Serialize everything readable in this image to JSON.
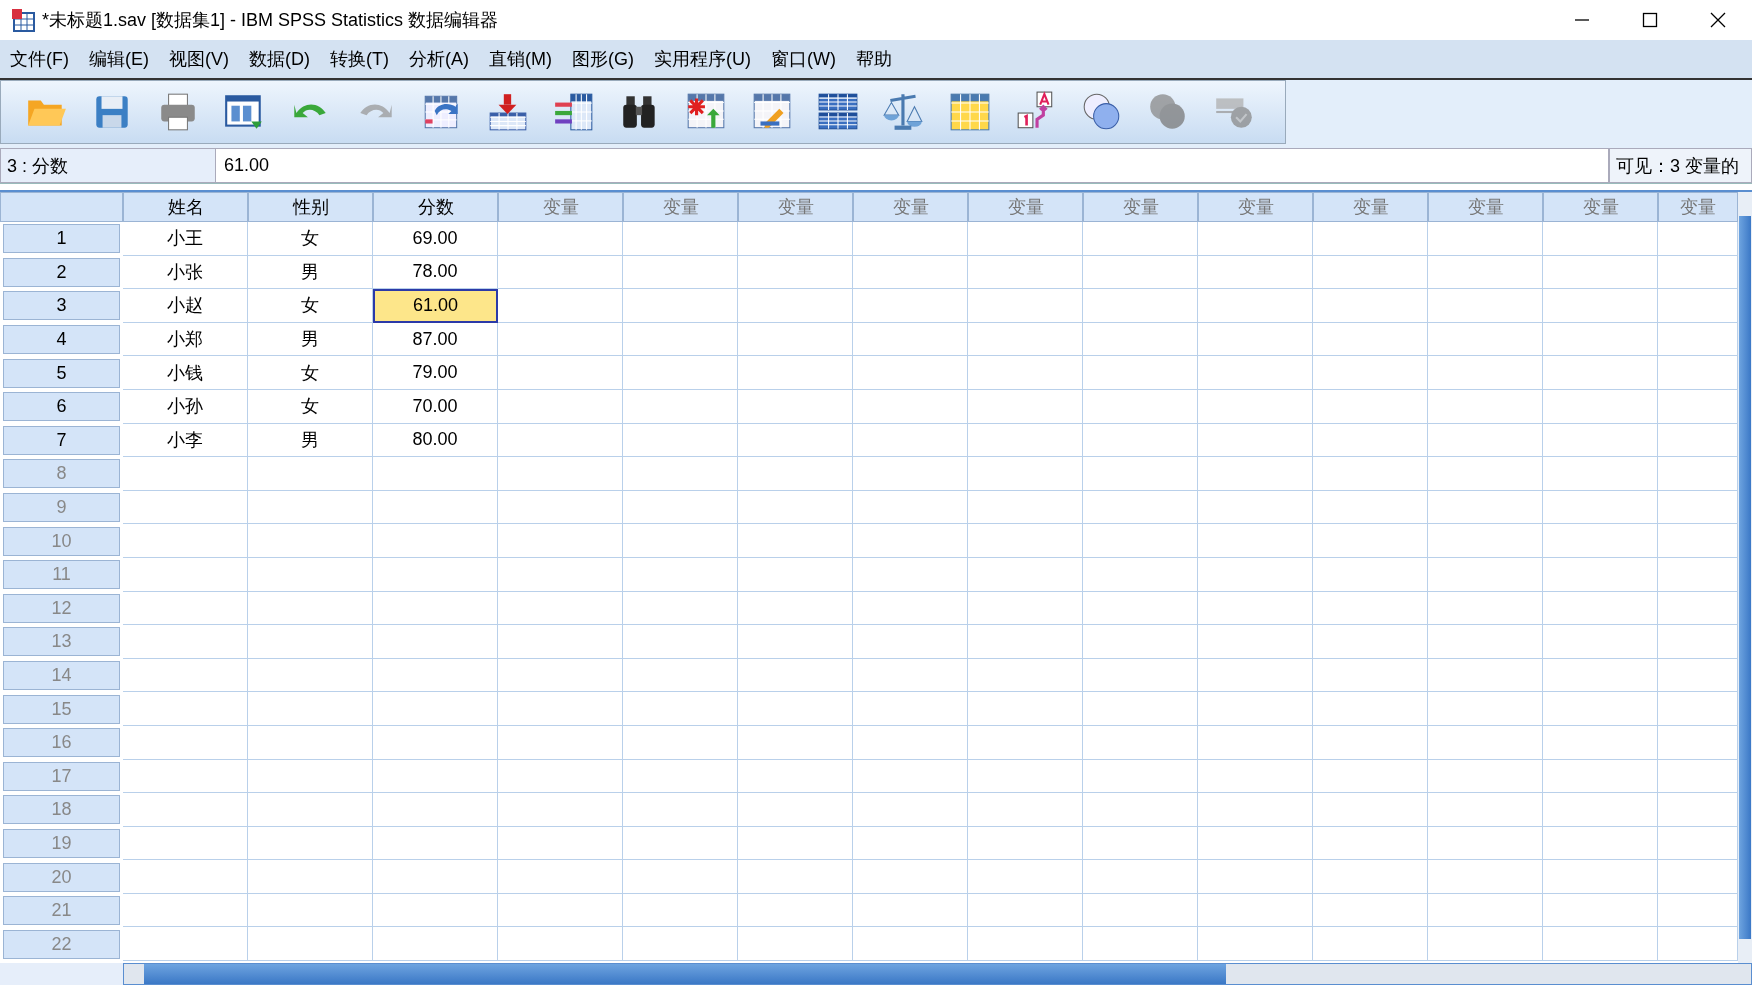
{
  "window": {
    "title": "*未标题1.sav [数据集1] - IBM SPSS Statistics 数据编辑器"
  },
  "menu": [
    "文件(F)",
    "编辑(E)",
    "视图(V)",
    "数据(D)",
    "转换(T)",
    "分析(A)",
    "直销(M)",
    "图形(G)",
    "实用程序(U)",
    "窗口(W)",
    "帮助"
  ],
  "toolbar": [
    {
      "kind": "open",
      "disabled": false
    },
    {
      "kind": "save",
      "disabled": false
    },
    {
      "kind": "print",
      "disabled": false
    },
    {
      "kind": "recall",
      "disabled": false
    },
    {
      "kind": "undo",
      "disabled": false
    },
    {
      "kind": "redo",
      "disabled": true
    },
    {
      "kind": "goto-case",
      "disabled": false
    },
    {
      "kind": "goto-var",
      "disabled": false
    },
    {
      "kind": "variables",
      "disabled": false
    },
    {
      "kind": "find",
      "disabled": false
    },
    {
      "kind": "insert-case",
      "disabled": false
    },
    {
      "kind": "insert-var",
      "disabled": false
    },
    {
      "kind": "split",
      "disabled": false
    },
    {
      "kind": "weight",
      "disabled": false
    },
    {
      "kind": "select",
      "disabled": false
    },
    {
      "kind": "labels",
      "disabled": false
    },
    {
      "kind": "sets",
      "disabled": false
    },
    {
      "kind": "show-all",
      "disabled": true
    },
    {
      "kind": "spell",
      "disabled": true
    }
  ],
  "cell_editor": {
    "reference": "3 : 分数",
    "value": "61.00",
    "visible": "可见：3 变量的"
  },
  "columns": [
    "姓名",
    "性别",
    "分数",
    "变量",
    "变量",
    "变量",
    "变量",
    "变量",
    "变量",
    "变量",
    "变量",
    "变量",
    "变量",
    "变量"
  ],
  "rows": [
    {
      "number": "1",
      "cells": [
        {
          "text": "小王",
          "selected": false
        },
        {
          "text": "女",
          "selected": false
        },
        {
          "text": "69.00",
          "selected": false
        }
      ]
    },
    {
      "number": "2",
      "cells": [
        {
          "text": "小张",
          "selected": false
        },
        {
          "text": "男",
          "selected": false
        },
        {
          "text": "78.00",
          "selected": false
        }
      ]
    },
    {
      "number": "3",
      "cells": [
        {
          "text": "小赵",
          "selected": false
        },
        {
          "text": "女",
          "selected": false
        },
        {
          "text": "61.00",
          "selected": true
        }
      ]
    },
    {
      "number": "4",
      "cells": [
        {
          "text": "小郑",
          "selected": false
        },
        {
          "text": "男",
          "selected": false
        },
        {
          "text": "87.00",
          "selected": false
        }
      ]
    },
    {
      "number": "5",
      "cells": [
        {
          "text": "小钱",
          "selected": false
        },
        {
          "text": "女",
          "selected": false
        },
        {
          "text": "79.00",
          "selected": false
        }
      ]
    },
    {
      "number": "6",
      "cells": [
        {
          "text": "小孙",
          "selected": false
        },
        {
          "text": "女",
          "selected": false
        },
        {
          "text": "70.00",
          "selected": false
        }
      ]
    },
    {
      "number": "7",
      "cells": [
        {
          "text": "小李",
          "selected": false
        },
        {
          "text": "男",
          "selected": false
        },
        {
          "text": "80.00",
          "selected": false
        }
      ]
    },
    {
      "number": "8"
    },
    {
      "number": "9"
    },
    {
      "number": "10"
    },
    {
      "number": "11"
    },
    {
      "number": "12"
    },
    {
      "number": "13"
    },
    {
      "number": "14"
    },
    {
      "number": "15"
    },
    {
      "number": "16"
    },
    {
      "number": "17"
    },
    {
      "number": "18"
    },
    {
      "number": "19"
    },
    {
      "number": "20"
    },
    {
      "number": "21"
    },
    {
      "number": "22"
    }
  ]
}
